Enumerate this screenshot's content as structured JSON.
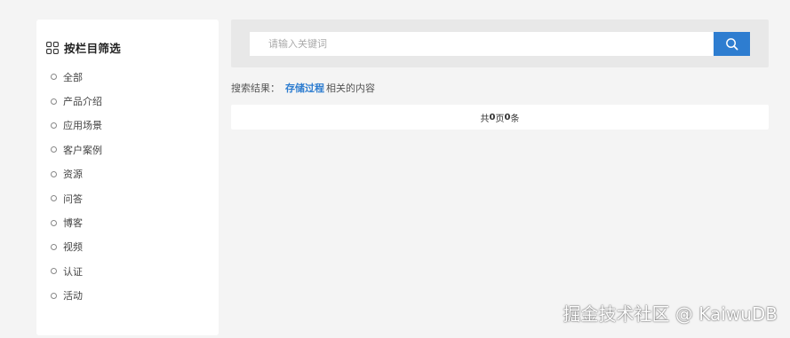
{
  "sidebar": {
    "title": "按栏目筛选",
    "icon": "grid-icon",
    "items": [
      {
        "label": "全部"
      },
      {
        "label": "产品介绍"
      },
      {
        "label": "应用场景"
      },
      {
        "label": "客户案例"
      },
      {
        "label": "资源"
      },
      {
        "label": "问答"
      },
      {
        "label": "博客"
      },
      {
        "label": "视频"
      },
      {
        "label": "认证"
      },
      {
        "label": "活动"
      }
    ]
  },
  "search": {
    "placeholder": "请输入关键词",
    "value": "",
    "button_icon": "search-icon"
  },
  "results": {
    "prefix": "搜索结果：",
    "keyword": "存储过程",
    "suffix": "相关的内容"
  },
  "count": {
    "pre": "共",
    "pages": "0",
    "mid": "页",
    "items": "0",
    "post": "条"
  },
  "watermark": "掘金技术社区 @ KaiwuDB",
  "colors": {
    "accent": "#2e7dd0",
    "page_background": "#f4f4f4",
    "search_panel_background": "#e8e8e8"
  }
}
